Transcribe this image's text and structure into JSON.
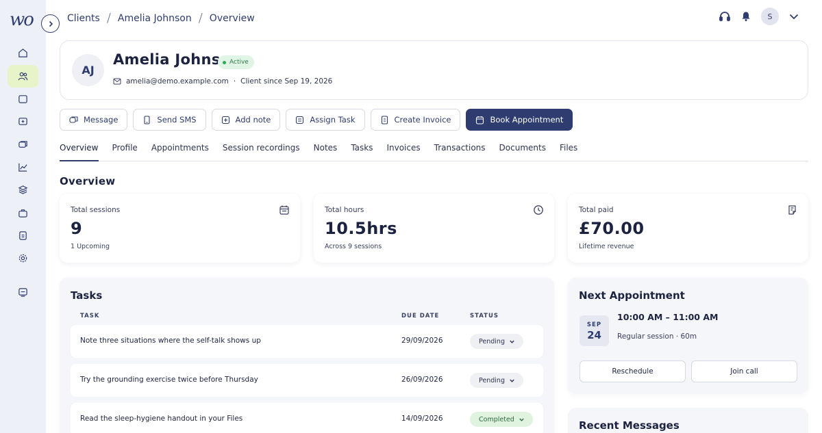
{
  "app": {
    "logo_text": "wo"
  },
  "sidebar": {
    "items": [
      {
        "name": "home"
      },
      {
        "name": "clients"
      },
      {
        "name": "calendar"
      },
      {
        "name": "services"
      },
      {
        "name": "messages"
      },
      {
        "name": "reports"
      },
      {
        "name": "resources"
      },
      {
        "name": "packages"
      },
      {
        "name": "forms"
      },
      {
        "name": "settings"
      },
      {
        "name": "support"
      }
    ],
    "active": "clients"
  },
  "breadcrumb": [
    "Clients",
    "Amelia Johnson",
    "Overview"
  ],
  "user": {
    "initial": "S"
  },
  "client": {
    "initials": "AJ",
    "name": "Amelia Johnson",
    "status": "Active",
    "email": "amelia@demo.example.com",
    "since": "Client since Sep 19, 2026"
  },
  "actions": {
    "message": "Message",
    "send_sms": "Send SMS",
    "add_note": "Add note",
    "assign_task": "Assign Task",
    "create_invoice": "Create Invoice",
    "book_appointment": "Book Appointment"
  },
  "tabs": [
    "Overview",
    "Profile",
    "Appointments",
    "Session recordings",
    "Notes",
    "Tasks",
    "Invoices",
    "Transactions",
    "Documents",
    "Files"
  ],
  "overview_title": "Overview",
  "stats": {
    "sessions": {
      "label": "Total sessions",
      "value": "9",
      "sub": "1 Upcoming"
    },
    "hours": {
      "label": "Total hours",
      "value": "10.5hrs",
      "sub": "Across 9 sessions"
    },
    "paid": {
      "label": "Total paid",
      "value": "£70.00",
      "sub": "Lifetime revenue"
    }
  },
  "tasks": {
    "title": "Tasks",
    "headers": {
      "task": "TASK",
      "due": "DUE DATE",
      "status": "STATUS"
    },
    "rows": [
      {
        "task": "Note three situations where the self-talk shows up",
        "due": "29/09/2026",
        "status": "Pending"
      },
      {
        "task": "Try the grounding exercise twice before Thursday",
        "due": "26/09/2026",
        "status": "Pending"
      },
      {
        "task": "Read the sleep-hygiene handout in your Files",
        "due": "14/09/2026",
        "status": "Completed"
      }
    ]
  },
  "next_appointment": {
    "title": "Next Appointment",
    "month": "SEP",
    "day": "24",
    "time": "10:00 AM – 11:00 AM",
    "type": "Regular session · 60m",
    "reschedule": "Reschedule",
    "join": "Join call"
  },
  "recent_messages": {
    "title": "Recent Messages"
  },
  "colors": {
    "primary": "#2e3c70",
    "active_nav": "#e7f3c9",
    "status_active": "#2fa85a"
  }
}
